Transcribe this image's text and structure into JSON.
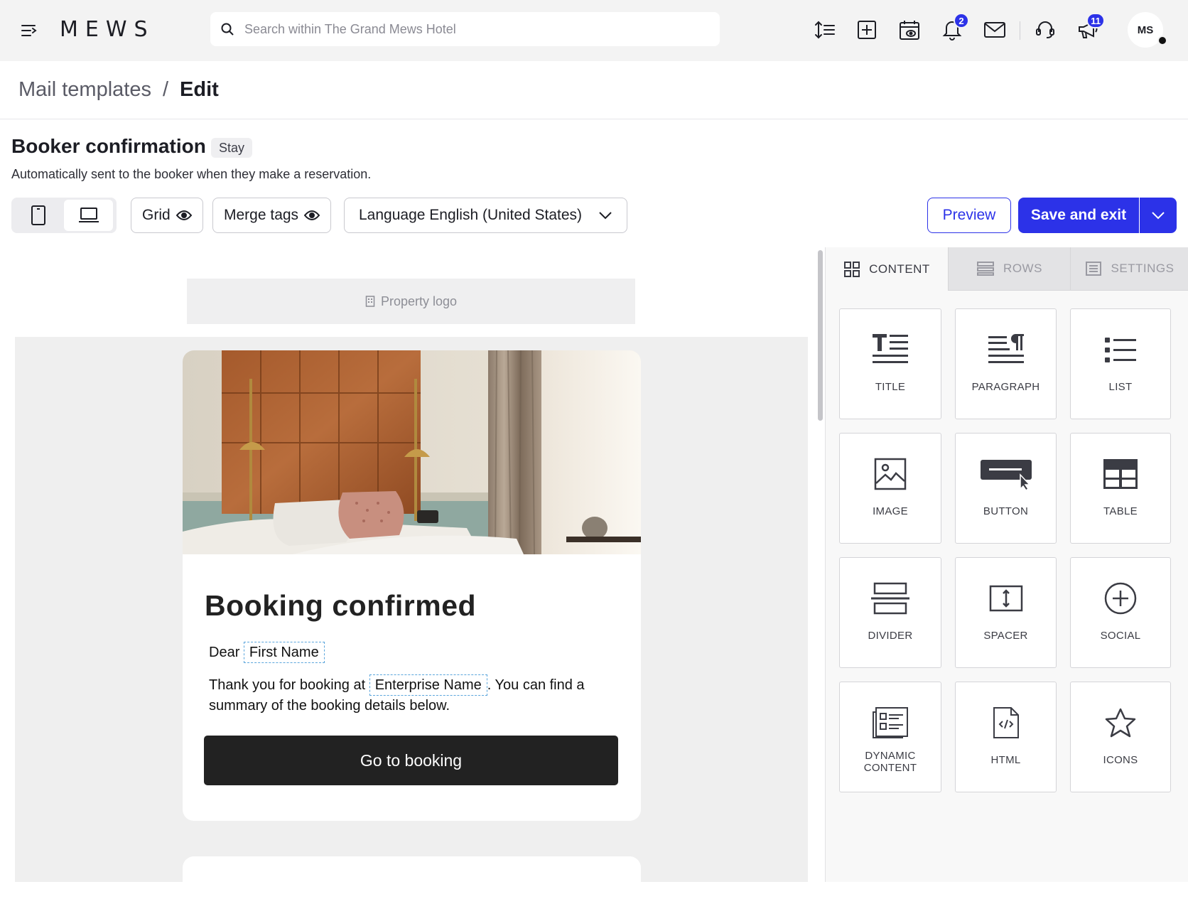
{
  "topbar": {
    "logo": "MEWS",
    "search_placeholder": "Search within The Grand Mews Hotel",
    "notifications_count": "2",
    "announcements_count": "11",
    "avatar_initials": "MS"
  },
  "breadcrumb": {
    "parent": "Mail templates",
    "separator": "/",
    "current": "Edit"
  },
  "template": {
    "title": "Booker confirmation",
    "tag": "Stay",
    "description": "Automatically sent to the booker when they make a reservation."
  },
  "toolbar": {
    "grid_label": "Grid",
    "merge_tags_label": "Merge tags",
    "language_label": "Language English (United States)",
    "preview_label": "Preview",
    "save_label": "Save and exit"
  },
  "email": {
    "logo_placeholder": "Property logo",
    "heading": "Booking confirmed",
    "greeting": "Dear",
    "first_name_tag": "First Name",
    "body_start": "Thank you for booking at",
    "enterprise_tag": "Enterprise Name",
    "body_end": ". You can find a",
    "body_line2": "summary of the booking details below.",
    "button_label": "Go to booking"
  },
  "panel": {
    "tabs": [
      {
        "label": "CONTENT",
        "icon": "grid-icon",
        "active": true
      },
      {
        "label": "ROWS",
        "icon": "rows-icon",
        "active": false
      },
      {
        "label": "SETTINGS",
        "icon": "settings-icon",
        "active": false
      }
    ],
    "blocks": [
      {
        "label": "TITLE",
        "icon": "title-icon"
      },
      {
        "label": "PARAGRAPH",
        "icon": "paragraph-icon"
      },
      {
        "label": "LIST",
        "icon": "list-icon"
      },
      {
        "label": "IMAGE",
        "icon": "image-icon"
      },
      {
        "label": "BUTTON",
        "icon": "button-icon"
      },
      {
        "label": "TABLE",
        "icon": "table-icon"
      },
      {
        "label": "DIVIDER",
        "icon": "divider-icon"
      },
      {
        "label": "SPACER",
        "icon": "spacer-icon"
      },
      {
        "label": "SOCIAL",
        "icon": "social-icon"
      },
      {
        "label": "DYNAMIC CONTENT",
        "icon": "dynamic-content-icon"
      },
      {
        "label": "HTML",
        "icon": "html-icon"
      },
      {
        "label": "ICONS",
        "icon": "star-icon"
      }
    ]
  },
  "colors": {
    "accent": "#2c32e8",
    "email_button": "#222222",
    "merge_tag_border": "#5aa5dc"
  }
}
